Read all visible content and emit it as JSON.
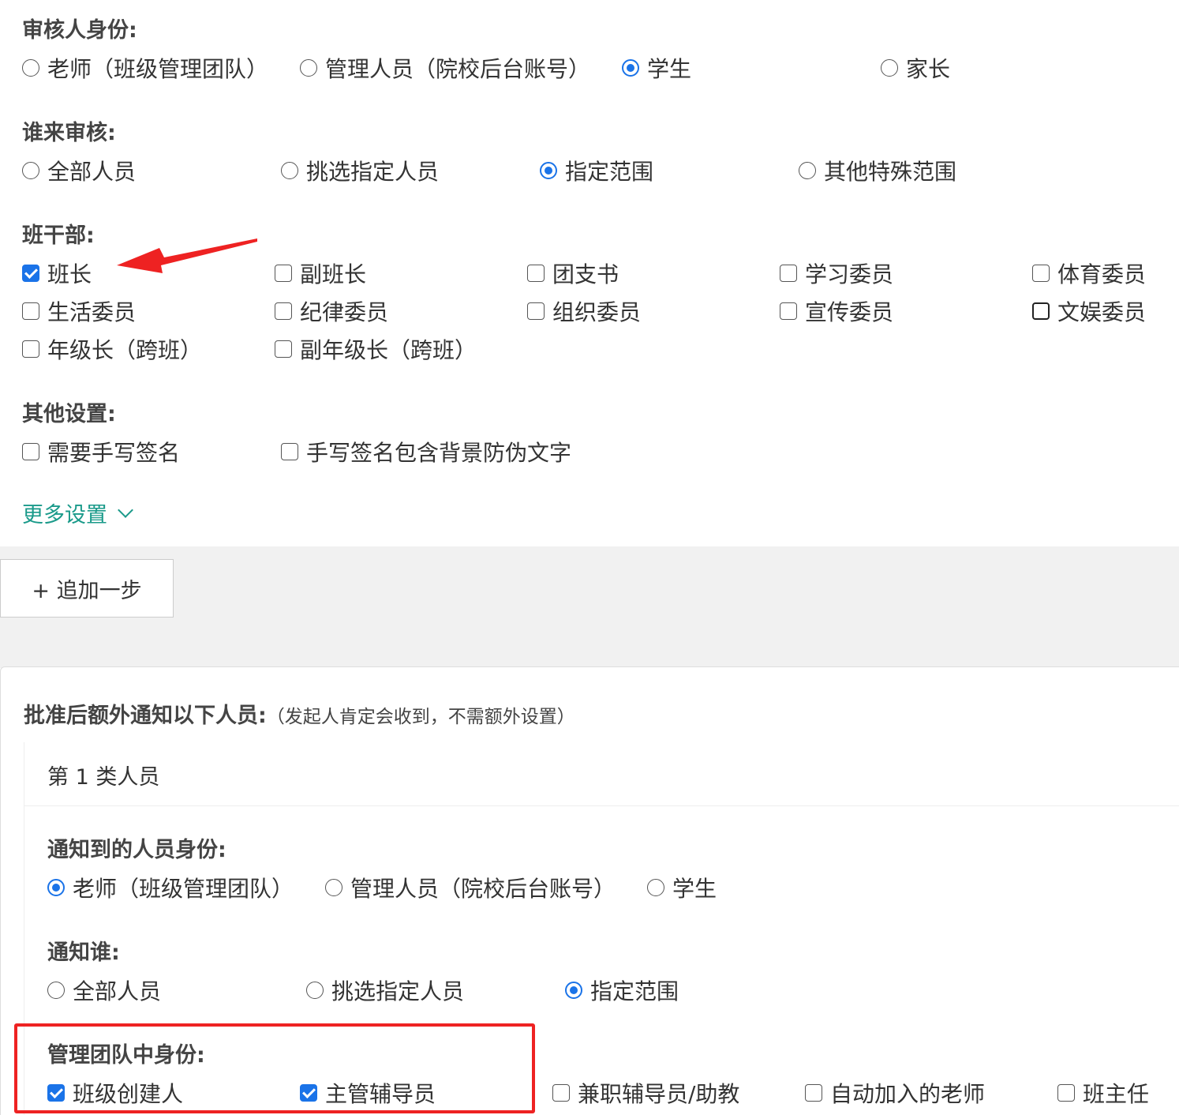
{
  "reviewer_identity": {
    "label": "审核人身份:",
    "options": [
      "老师（班级管理团队）",
      "管理人员（院校后台账号）",
      "学生",
      "家长"
    ],
    "selected": "学生"
  },
  "who_reviews": {
    "label": "谁来审核:",
    "options": [
      "全部人员",
      "挑选指定人员",
      "指定范围",
      "其他特殊范围"
    ],
    "selected": "指定范围"
  },
  "class_cadre": {
    "label": "班干部:",
    "items": [
      {
        "label": "班长",
        "checked": true
      },
      {
        "label": "副班长",
        "checked": false
      },
      {
        "label": "团支书",
        "checked": false
      },
      {
        "label": "学习委员",
        "checked": false
      },
      {
        "label": "体育委员",
        "checked": false
      },
      {
        "label": "生活委员",
        "checked": false
      },
      {
        "label": "纪律委员",
        "checked": false
      },
      {
        "label": "组织委员",
        "checked": false
      },
      {
        "label": "宣传委员",
        "checked": false
      },
      {
        "label": "文娱委员",
        "checked": false
      },
      {
        "label": "年级长（跨班）",
        "checked": false
      },
      {
        "label": "副年级长（跨班）",
        "checked": false
      }
    ]
  },
  "other_settings": {
    "label": "其他设置:",
    "items": [
      {
        "label": "需要手写签名",
        "checked": false
      },
      {
        "label": "手写签名包含背景防伪文字",
        "checked": false
      }
    ]
  },
  "more_settings": "更多设置",
  "add_step": "+ 追加一步",
  "notify": {
    "title": "批准后额外通知以下人员:",
    "note": "（发起人肯定会收到，不需额外设置）",
    "category": "第 1 类人员",
    "identity_label": "通知到的人员身份:",
    "identity_options": [
      "老师（班级管理团队）",
      "管理人员（院校后台账号）",
      "学生"
    ],
    "identity_selected": "老师（班级管理团队）",
    "who_label": "通知谁:",
    "who_options": [
      "全部人员",
      "挑选指定人员",
      "指定范围"
    ],
    "who_selected": "指定范围",
    "team_label": "管理团队中身份:",
    "team_items": [
      {
        "label": "班级创建人",
        "checked": true
      },
      {
        "label": "主管辅导员",
        "checked": true
      },
      {
        "label": "兼职辅导员/助教",
        "checked": false
      },
      {
        "label": "自动加入的老师",
        "checked": false
      },
      {
        "label": "班主任",
        "checked": false
      }
    ]
  },
  "colors": {
    "accent": "#1a73e8",
    "link": "#1a9a8a",
    "annotation": "#ee2222"
  }
}
